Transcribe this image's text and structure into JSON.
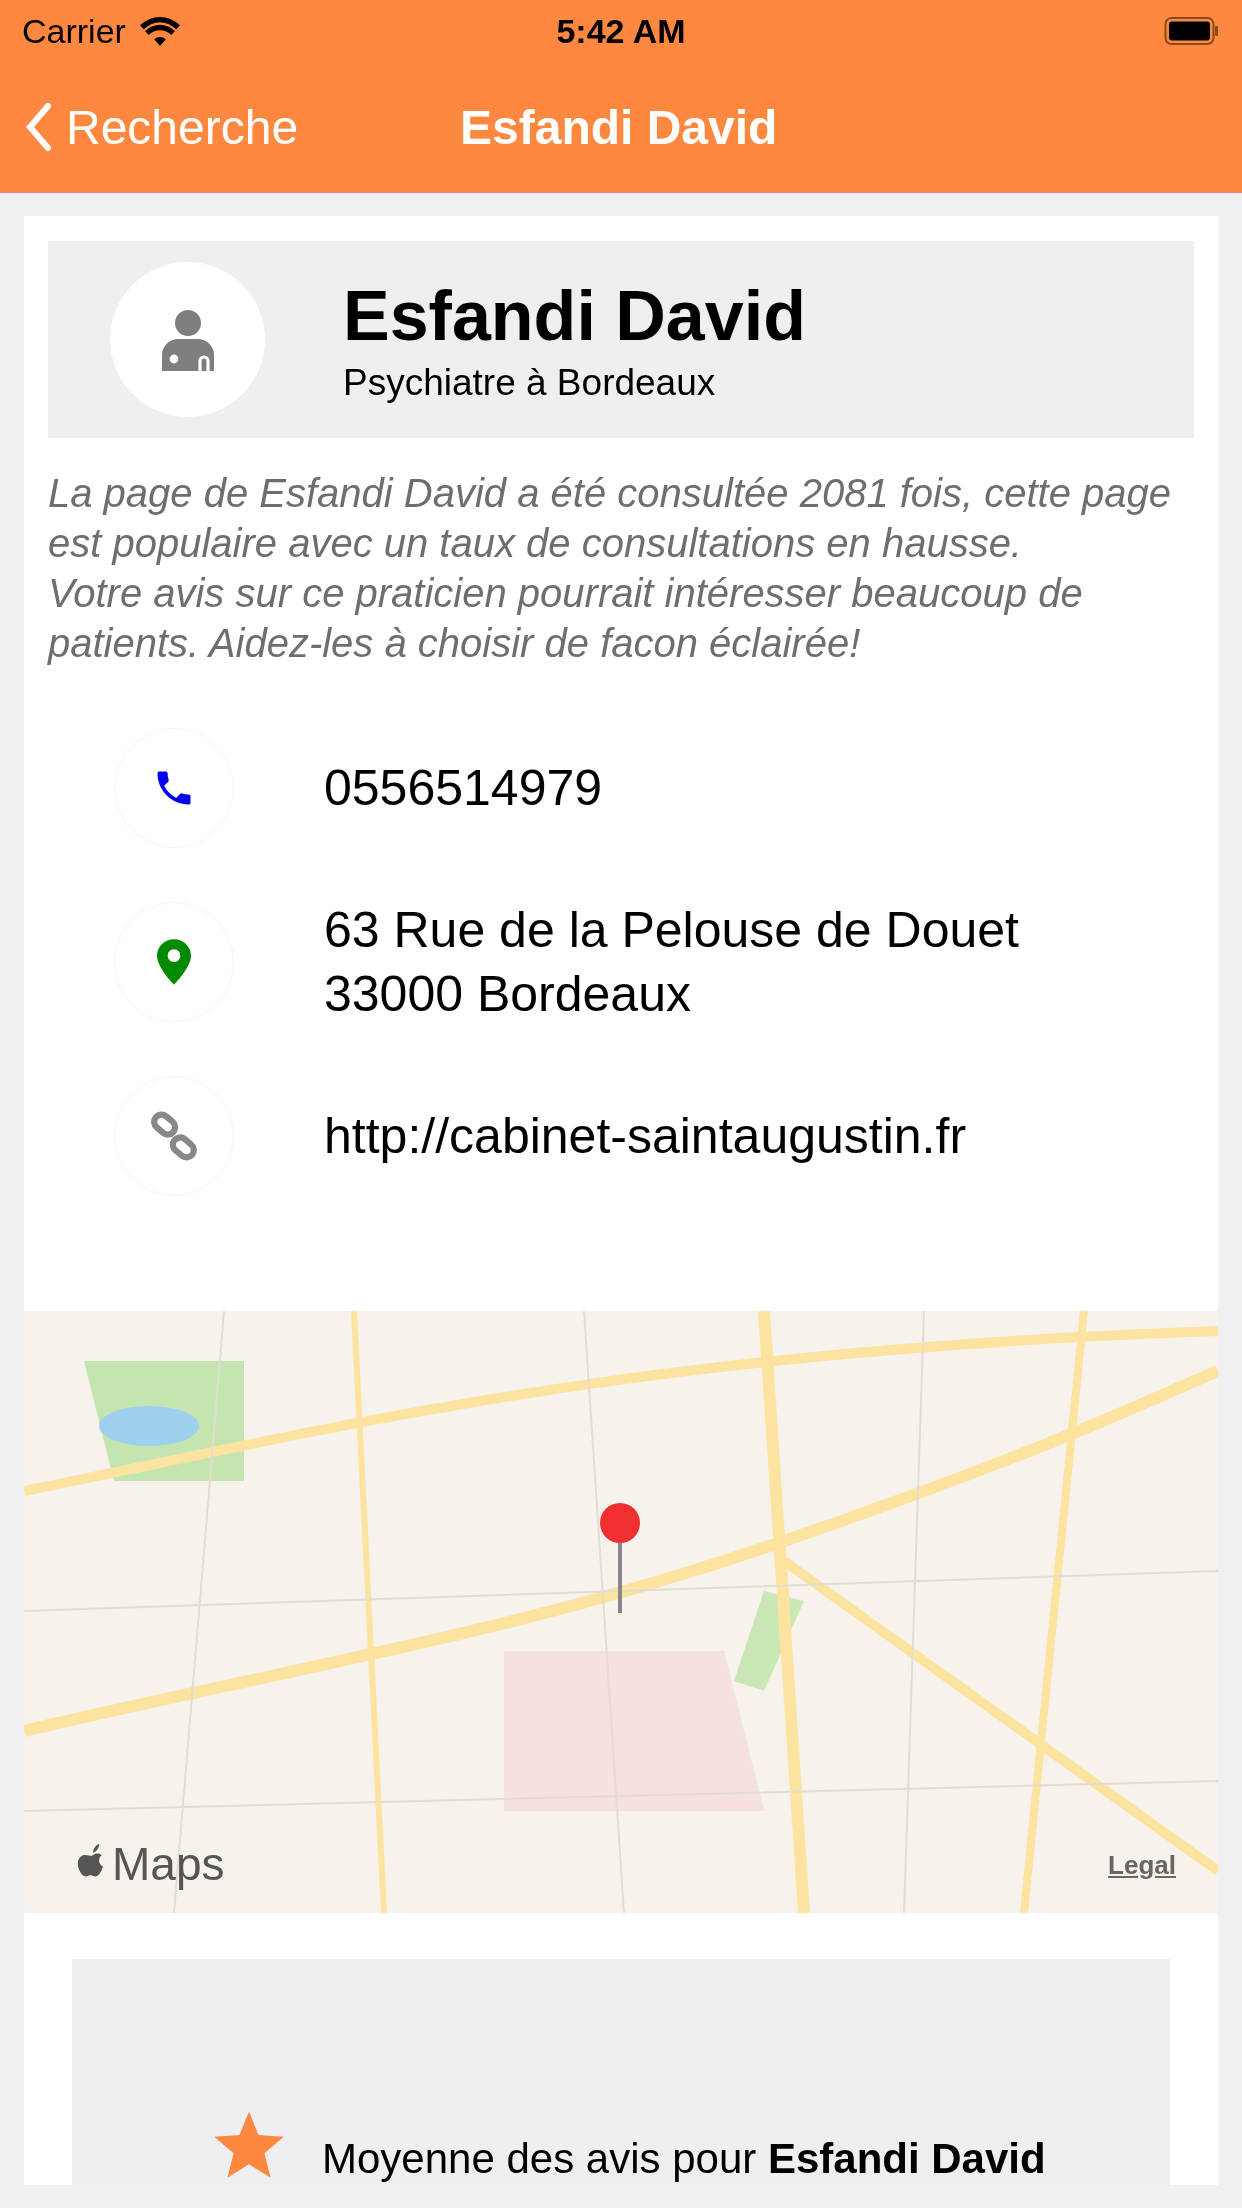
{
  "status_bar": {
    "carrier": "Carrier",
    "time": "5:42 AM"
  },
  "nav": {
    "back": "Recherche",
    "title": "Esfandi David"
  },
  "profile": {
    "name": "Esfandi David",
    "subtitle": "Psychiatre à Bordeaux"
  },
  "description": [
    "La page de Esfandi David a été consultée 2081 fois, cette page est populaire avec un taux de consultations en hausse.",
    "Votre avis sur ce praticien pourrait intéresser beaucoup de patients. Aidez-les à choisir de facon éclairée!"
  ],
  "contacts": [
    {
      "kind": "phone",
      "lines": [
        "0556514979"
      ]
    },
    {
      "kind": "address",
      "lines": [
        "63 Rue de la Pelouse de Douet",
        "33000 Bordeaux"
      ]
    },
    {
      "kind": "website",
      "lines": [
        "http://cabinet-saintaugustin.fr"
      ]
    }
  ],
  "map": {
    "kind": "picture",
    "brand": "Maps",
    "legal": "Legal"
  },
  "rating": {
    "text": "Moyenne des avis pour **Esfandi David**"
  }
}
